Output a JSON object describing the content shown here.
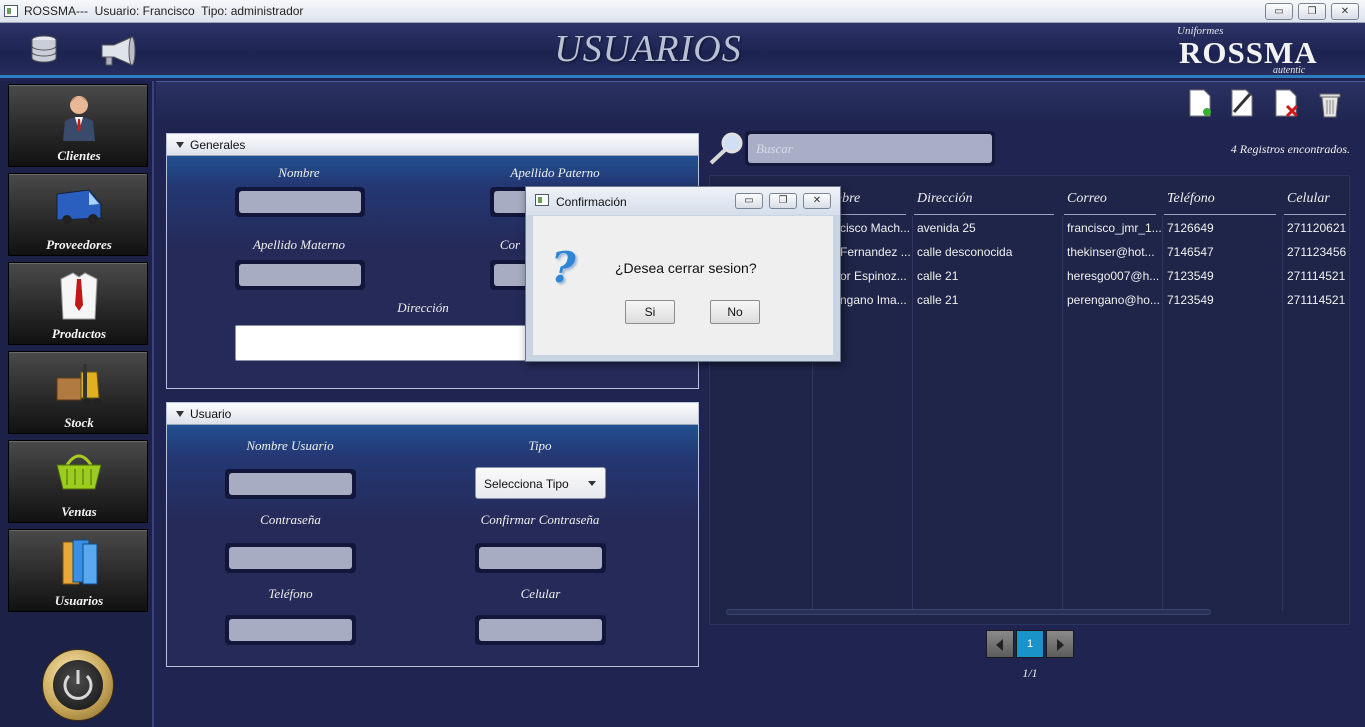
{
  "window": {
    "title": "ROSSMA---  Usuario: Francisco  Tipo: administrador",
    "controls": {
      "minimize": "▭",
      "maximize": "❐",
      "close": "✕"
    }
  },
  "header": {
    "title": "USUARIOS",
    "logo": {
      "small": "Uniformes",
      "main": "ROSSMA",
      "sub": "autentic"
    }
  },
  "sidebar": {
    "items": [
      {
        "label": "Clientes",
        "icon": "client-icon"
      },
      {
        "label": "Proveedores",
        "icon": "van-icon"
      },
      {
        "label": "Productos",
        "icon": "shirt-icon"
      },
      {
        "label": "Stock",
        "icon": "forklift-icon"
      },
      {
        "label": "Ventas",
        "icon": "basket-icon"
      },
      {
        "label": "Usuarios",
        "icon": "folders-icon"
      }
    ]
  },
  "toolbar": {
    "icons": [
      "new-document-icon",
      "edit-document-icon",
      "delete-document-icon",
      "trash-icon"
    ]
  },
  "generales": {
    "title": "Generales",
    "nombre_label": "Nombre",
    "apellido_paterno_label": "Apellido Paterno",
    "apellido_materno_label": "Apellido Materno",
    "correo_label": "Cor",
    "direccion_label": "Dirección"
  },
  "usuario_panel": {
    "title": "Usuario",
    "nombre_usuario_label": "Nombre Usuario",
    "tipo_label": "Tipo",
    "tipo_value": "Selecciona Tipo",
    "contrasena_label": "Contraseña",
    "confirmar_label": "Confirmar Contraseña",
    "telefono_label": "Teléfono",
    "celular_label": "Celular"
  },
  "search": {
    "placeholder": "Buscar"
  },
  "records": {
    "count_text": "4 Registros encontrados."
  },
  "table": {
    "columns": [
      "mbre",
      "Dirección",
      "Correo",
      "Teléfono",
      "Celular"
    ],
    "rows": [
      [
        "cisco Mach...",
        "avenida 25",
        "francisco_jmr_1...",
        "7126649",
        "271120621"
      ],
      [
        "Fernandez ...",
        "calle desconocida",
        "thekinser@hot...",
        "7146547",
        "271123456"
      ],
      [
        "or Espinoz...",
        "calle 21",
        "heresgo007@h...",
        "7123549",
        "271114521"
      ],
      [
        "ngano Ima...",
        "calle 21",
        "perengano@ho...",
        "7123549",
        "271114521"
      ]
    ]
  },
  "pagination": {
    "current": "1",
    "info": "1/1"
  },
  "dialog": {
    "title": "Confirmación",
    "message": "¿Desea cerrar sesion?",
    "icon": "question-icon",
    "yes_label": "Si",
    "no_label": "No"
  },
  "colors": {
    "background": "#1f2550",
    "accent": "#2f7fc0",
    "page_active": "#1a93c8"
  }
}
